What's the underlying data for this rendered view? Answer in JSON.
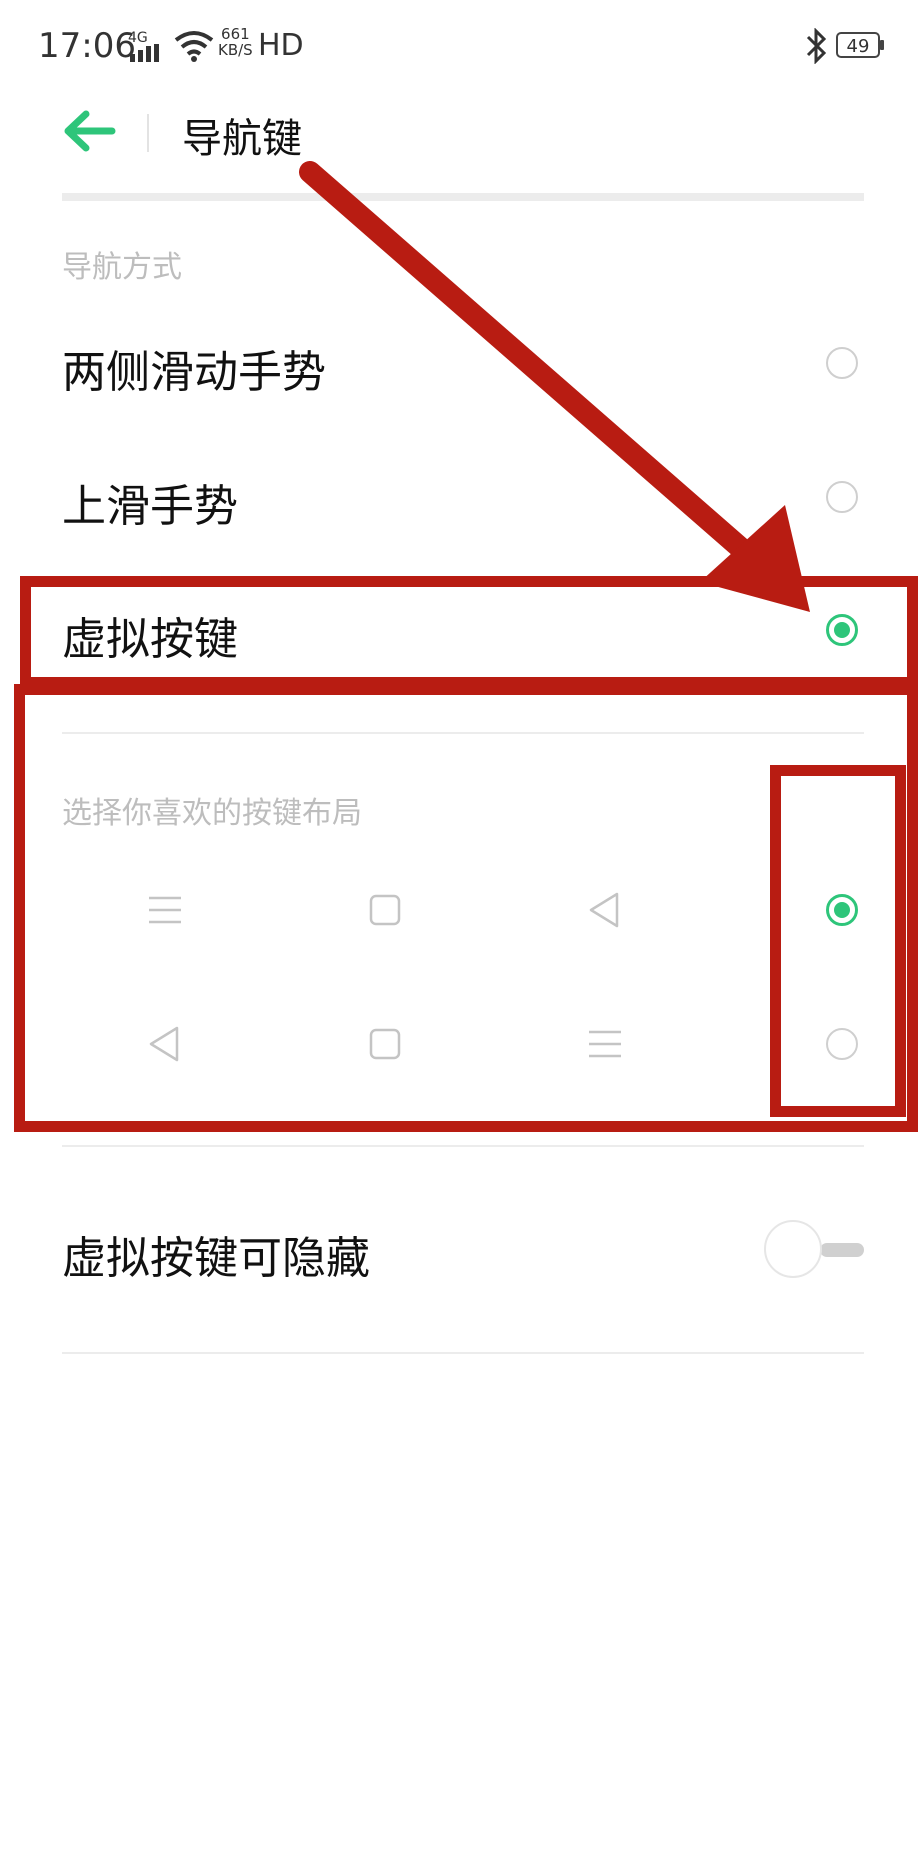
{
  "status_bar": {
    "time": "17:06",
    "network_label": "4G",
    "speed_value": "661",
    "speed_unit": "KB/S",
    "hd_label": "HD",
    "battery": "49"
  },
  "header": {
    "title": "导航键",
    "back_icon": "back-arrow-icon"
  },
  "nav_method": {
    "section_title": "导航方式",
    "options": [
      {
        "label": "两侧滑动手势",
        "selected": false
      },
      {
        "label": "上滑手势",
        "selected": false
      },
      {
        "label": "虚拟按键",
        "selected": true
      }
    ]
  },
  "key_layout": {
    "section_title": "选择你喜欢的按键布局",
    "layouts": [
      {
        "icons": [
          "menu-icon",
          "home-square-icon",
          "back-triangle-icon"
        ],
        "selected": true
      },
      {
        "icons": [
          "back-triangle-icon",
          "home-square-icon",
          "menu-icon"
        ],
        "selected": false
      }
    ]
  },
  "hide_keys": {
    "label": "虚拟按键可隐藏",
    "enabled": false
  },
  "colors": {
    "accent": "#2ec57a",
    "annotation": "#b81c12"
  }
}
